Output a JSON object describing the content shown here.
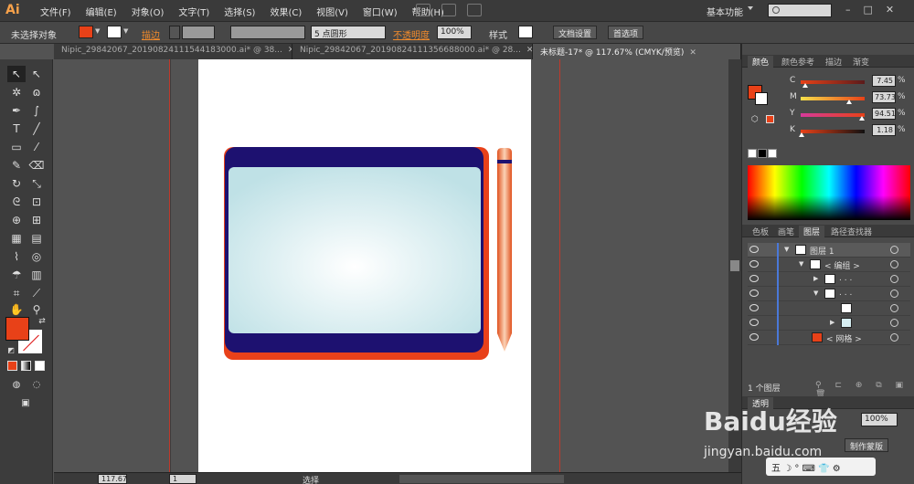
{
  "app": {
    "logo": "Ai",
    "workspace": "基本功能",
    "win_min": "–",
    "win_max": "□",
    "win_close": "✕"
  },
  "menu": [
    "文件(F)",
    "编辑(E)",
    "对象(O)",
    "文字(T)",
    "选择(S)",
    "效果(C)",
    "视图(V)",
    "窗口(W)",
    "帮助(H)"
  ],
  "control": {
    "selection": "未选择对象",
    "stroke_label": "描边",
    "stroke_weight": "",
    "brush": "5 点圆形",
    "opacity_label": "不透明度",
    "opacity": "100%",
    "style_label": "样式",
    "doc_setup": "文档设置",
    "prefs": "首选项"
  },
  "tabs": [
    {
      "label": "Nipic_29842067_20190824111544183000.ai* @ 38...",
      "close": "✕"
    },
    {
      "label": "Nipic_29842067_20190824111356688000.ai* @ 28...",
      "close": "✕"
    },
    {
      "label": "未标题-17* @ 117.67% (CMYK/预览)",
      "close": "✕"
    }
  ],
  "status": {
    "zoom": "117.67",
    "page": "1",
    "tool": "选择"
  },
  "color_panel": {
    "tabs": [
      "颜色",
      "颜色参考",
      "描边",
      "渐变"
    ],
    "channels": [
      {
        "label": "C",
        "value": "7.45",
        "pct": "%",
        "level": 0.0745
      },
      {
        "label": "M",
        "value": "73.73",
        "pct": "%",
        "level": 0.7373
      },
      {
        "label": "Y",
        "value": "94.51",
        "pct": "%",
        "level": 0.9451
      },
      {
        "label": "K",
        "value": "1.18",
        "pct": "%",
        "level": 0.0118
      }
    ]
  },
  "layers_panel": {
    "tabs": [
      "色板",
      "画笔",
      "图层",
      "路径查找器"
    ],
    "rows": [
      {
        "name": "图层 1",
        "indent": 0,
        "twirl": "▼"
      },
      {
        "name": "< 编组 >",
        "indent": 1,
        "twirl": "▼"
      },
      {
        "name": ". . .",
        "indent": 2,
        "twirl": "▶"
      },
      {
        "name": ". . .",
        "indent": 2,
        "twirl": "▼"
      },
      {
        "name": "",
        "indent": 3,
        "twirl": ""
      },
      {
        "name": "",
        "indent": 3,
        "twirl": "▶"
      },
      {
        "name": "< 网格 >",
        "indent": 1,
        "twirl": ""
      }
    ],
    "footer": "1 个图层"
  },
  "transparency": {
    "title": "透明",
    "opacity": "100%",
    "make_mask": "制作蒙版"
  },
  "watermark": {
    "brand": "Baidu经验",
    "url": "jingyan.baidu.com"
  },
  "ime": {
    "text": "五 ☽ ° ⌨ 👕 ⚙"
  },
  "colors": {
    "fill": "#e84118",
    "tablet_frame": "#1d1170",
    "tablet_border": "#e8411a",
    "pen": "#e05a2b"
  }
}
